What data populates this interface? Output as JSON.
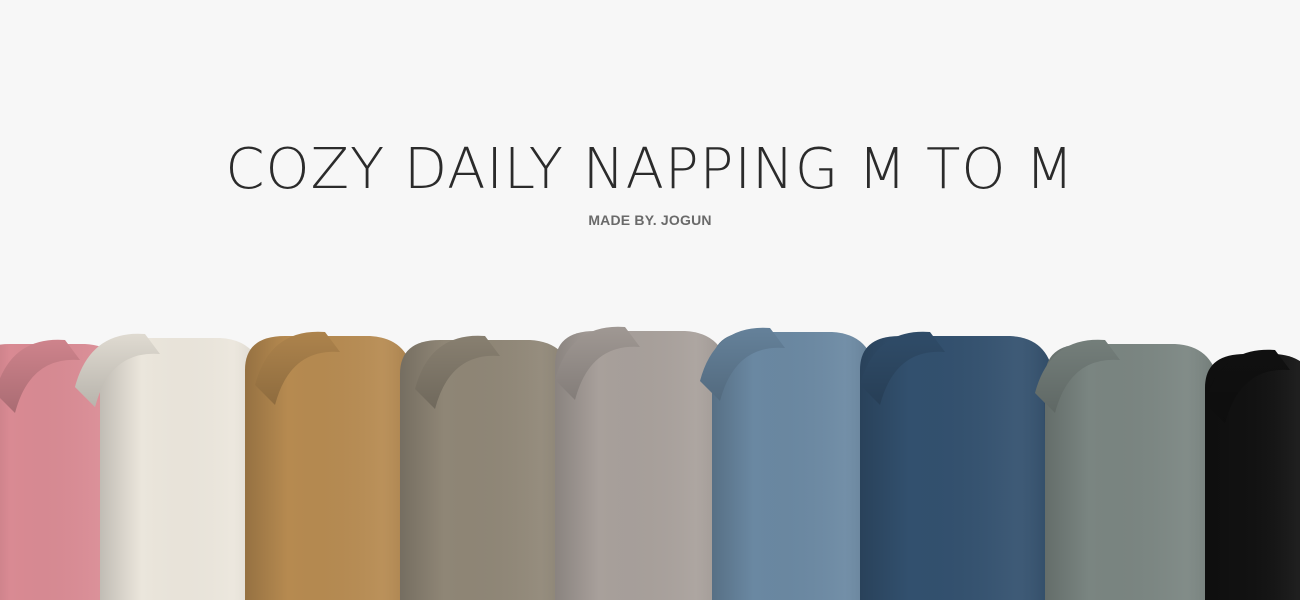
{
  "banner": {
    "title": "COZY DAILY NAPPING M TO M",
    "subtitle": "MADE BY. JOGUN"
  },
  "sweaters": [
    {
      "name": "pink",
      "color": "#d98a93"
    },
    {
      "name": "ivory",
      "color": "#ebe6dc"
    },
    {
      "name": "camel",
      "color": "#b68a50"
    },
    {
      "name": "khaki-gray",
      "color": "#8f8676"
    },
    {
      "name": "light-gray",
      "color": "#a8a09b"
    },
    {
      "name": "sky-blue",
      "color": "#6a88a2"
    },
    {
      "name": "navy",
      "color": "#32506e"
    },
    {
      "name": "sage-gray",
      "color": "#7a8581"
    },
    {
      "name": "black",
      "color": "#111111"
    }
  ]
}
